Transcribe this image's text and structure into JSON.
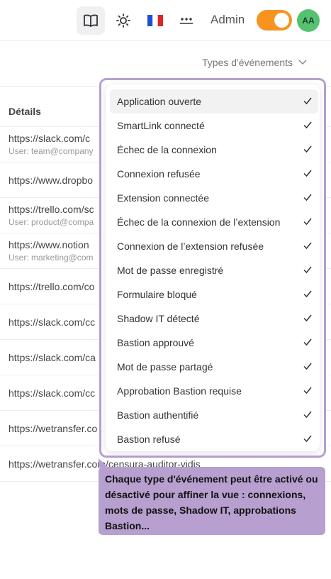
{
  "header": {
    "icons": [
      "book-icon",
      "sun-icon",
      "french-flag-icon",
      "dots-icon"
    ],
    "admin_label": "Admin",
    "avatar_initials": "AA",
    "colors": {
      "toggle": "#f7931e",
      "avatar": "#56c271"
    }
  },
  "filter": {
    "types_label": "Types d'événements"
  },
  "table": {
    "header": "Détails",
    "rows": [
      {
        "url": "https://slack.com/c",
        "user": "User: team@company"
      },
      {
        "url": "https://www.dropbo",
        "user": ""
      },
      {
        "url": "https://trello.com/sc",
        "user": "User: product@compa"
      },
      {
        "url": "https://www.notion",
        "user": "User: marketing@com"
      },
      {
        "url": "https://trello.com/co",
        "user": ""
      },
      {
        "url": "https://slack.com/cc",
        "user": ""
      },
      {
        "url": "https://slack.com/ca",
        "user": ""
      },
      {
        "url": "https://slack.com/cc",
        "user": ""
      },
      {
        "url": "https://wetransfer.co",
        "user": ""
      },
      {
        "url": "https://wetransfer.com/censura-auditor-vidis",
        "user": ""
      }
    ]
  },
  "dropdown": {
    "options": [
      "Application ouverte",
      "SmartLink connecté",
      "Échec de la connexion",
      "Connexion refusée",
      "Extension connectée",
      "Échec de la connexion de l’extension",
      "Connexion de l’extension refusée",
      "Mot de passe enregistré",
      "Formulaire bloqué",
      "Shadow IT détecté",
      "Bastion approuvé",
      "Mot de passe partagé",
      "Approbation Bastion requise",
      "Bastion authentifié",
      "Bastion refusé"
    ]
  },
  "tooltip": {
    "text": "Chaque type d'événement peut être activé ou désactivé pour affiner la vue : connexions, mots de passe, Shadow IT, approbations Bastion..."
  }
}
